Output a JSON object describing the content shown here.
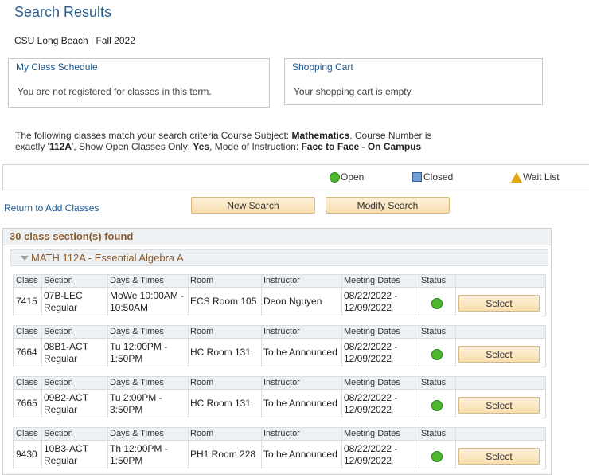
{
  "header": {
    "title": "Search Results",
    "subtitle": "CSU Long Beach | Fall 2022"
  },
  "schedule_box": {
    "title": "My Class Schedule",
    "text": "You are not registered for classes in this term."
  },
  "cart_box": {
    "title": "Shopping Cart",
    "text": "Your shopping cart is empty."
  },
  "criteria": {
    "intro": "The following classes match your search criteria Course Subject: ",
    "subject": "Mathematics",
    "number_label": ",  Course Number is exactly '",
    "number": "112A",
    "open_label": "',  Show Open Classes Only: ",
    "open_value": "Yes",
    "mode_label": ",  Mode of Instruction: ",
    "mode_value": "Face to Face - On Campus"
  },
  "legend": {
    "open": "Open",
    "closed": "Closed",
    "wait": "Wait List",
    "colors": {
      "open": "#4ab92e",
      "closed": "#6f9fd5",
      "wait": "#e4a70d"
    }
  },
  "actions": {
    "return_link": "Return to Add Classes",
    "new_search": "New Search",
    "modify_search": "Modify Search"
  },
  "results": {
    "count_text": "30 class section(s) found",
    "course_title": "MATH 112A - Essential Algebra A",
    "columns": [
      "Class",
      "Section",
      "Days & Times",
      "Room",
      "Instructor",
      "Meeting Dates",
      "Status"
    ],
    "select_label": "Select",
    "sections": [
      {
        "class_nbr": "7415",
        "section_code": "07B-LEC",
        "section_type": "Regular",
        "days_1": "MoWe 10:00AM -",
        "days_2": "10:50AM",
        "room": "ECS  Room 105",
        "instructor": "Deon Nguyen",
        "dates_1": "08/22/2022 -",
        "dates_2": "12/09/2022",
        "status": "open"
      },
      {
        "class_nbr": "7664",
        "section_code": "08B1-ACT",
        "section_type": "Regular",
        "days_1": "Tu 12:00PM -",
        "days_2": "1:50PM",
        "room": "HC  Room 131",
        "instructor": "To be Announced",
        "dates_1": "08/22/2022 -",
        "dates_2": "12/09/2022",
        "status": "open"
      },
      {
        "class_nbr": "7665",
        "section_code": "09B2-ACT",
        "section_type": "Regular",
        "days_1": "Tu 2:00PM -",
        "days_2": "3:50PM",
        "room": "HC  Room 131",
        "instructor": "To be Announced",
        "dates_1": "08/22/2022 -",
        "dates_2": "12/09/2022",
        "status": "open"
      },
      {
        "class_nbr": "9430",
        "section_code": "10B3-ACT",
        "section_type": "Regular",
        "days_1": "Th 12:00PM -",
        "days_2": "1:50PM",
        "room": "PH1  Room 228",
        "instructor": "To be Announced",
        "dates_1": "08/22/2022 -",
        "dates_2": "12/09/2022",
        "status": "open"
      }
    ]
  }
}
